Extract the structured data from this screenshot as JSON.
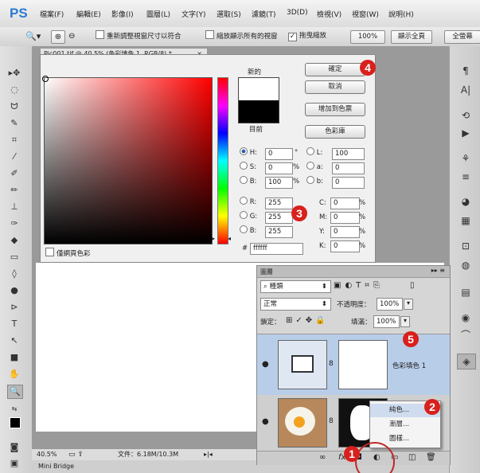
{
  "app": {
    "logo": "PS"
  },
  "menu": [
    "檔案(F)",
    "編輯(E)",
    "影像(I)",
    "圖層(L)",
    "文字(Y)",
    "選取(S)",
    "濾鏡(T)",
    "3D(D)",
    "檢視(V)",
    "視窗(W)",
    "說明(H)"
  ],
  "options": {
    "resize_window": "重新調整視窗尺寸以符合",
    "zoom_all": "縮放顯示所有的視窗",
    "scrubby_zoom": "拖曳縮放",
    "zoom_value": "100%",
    "fit_screen": "顯示全頁",
    "fill_screen": "全螢幕"
  },
  "document": {
    "tab_title": "Pic001.tif @ 40.5% (色彩填色 1, RGB/8) *",
    "tab_close": "×",
    "zoom": "40.5%",
    "file_info": "文件：6.18M/10.3M",
    "mini_bridge": "Mini Bridge"
  },
  "color_picker": {
    "new_label": "新的",
    "current_label": "目前",
    "ok": "確定",
    "cancel": "取消",
    "add_swatch": "增加到色票",
    "color_libraries": "色彩庫",
    "web_only": "僅網頁色彩",
    "hsb": [
      {
        "label": "H:",
        "value": "0",
        "unit": "°"
      },
      {
        "label": "S:",
        "value": "0",
        "unit": "%"
      },
      {
        "label": "B:",
        "value": "100",
        "unit": "%"
      }
    ],
    "rgb": [
      {
        "label": "R:",
        "value": "255"
      },
      {
        "label": "G:",
        "value": "255"
      },
      {
        "label": "B:",
        "value": "255"
      }
    ],
    "lab": [
      {
        "label": "L:",
        "value": "100"
      },
      {
        "label": "a:",
        "value": "0"
      },
      {
        "label": "b:",
        "value": "0"
      }
    ],
    "cmyk": [
      {
        "label": "C:",
        "value": "0",
        "unit": "%"
      },
      {
        "label": "M:",
        "value": "0",
        "unit": "%"
      },
      {
        "label": "Y:",
        "value": "0",
        "unit": "%"
      },
      {
        "label": "K:",
        "value": "0",
        "unit": "%"
      }
    ],
    "hex_label": "#",
    "hex_value": "ffffff"
  },
  "layers": {
    "panel_title": "圖層",
    "kind": "種類",
    "blend_mode": "正常",
    "opacity_label": "不透明度：",
    "opacity_value": "100%",
    "lock_label": "鎖定：",
    "fill_label": "填滿：",
    "fill_value": "100%",
    "layer1_name": "色彩填色 1"
  },
  "context_menu": [
    "純色...",
    "漸層...",
    "圖樣..."
  ],
  "badges": [
    "1",
    "2",
    "3",
    "4",
    "5"
  ],
  "colors": {
    "badge": "#d8201c",
    "selected_layer": "#b8cde8"
  }
}
